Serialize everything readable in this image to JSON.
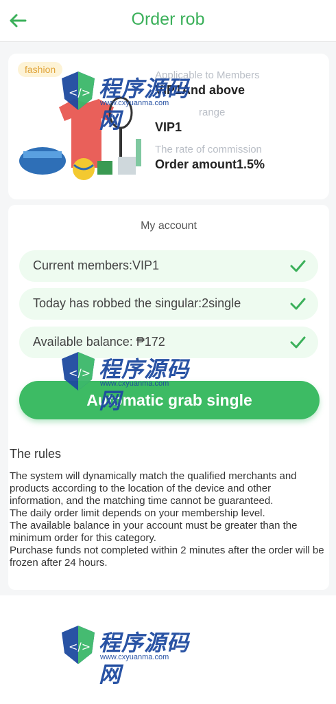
{
  "header": {
    "title": "Order rob"
  },
  "product": {
    "tag": "fashion",
    "fields": [
      {
        "label": "Applicable to Members",
        "value": "VIP1And above"
      },
      {
        "label": "range",
        "value": "VIP1"
      },
      {
        "label": "The rate of commission",
        "value": "Order amount1.5%"
      }
    ]
  },
  "account": {
    "title": "My account",
    "rows": [
      "Current members:VIP1",
      "Today has robbed the singular:2single",
      "Available balance: ₱172"
    ],
    "button": "Automatic grab single"
  },
  "rules": {
    "title": "The rules",
    "paragraphs": [
      "The system will dynamically match the qualified merchants and products according to the location of the device and other information, and the matching time cannot be guaranteed.",
      "The daily order limit depends on your membership level.",
      "The available balance in your account must be greater than the minimum order for this category.",
      "Purchase funds not completed within 2 minutes after the order will be frozen after 24 hours."
    ]
  },
  "watermark": {
    "text": "程序源码网",
    "url": "www.cxyuanma.com"
  },
  "colors": {
    "accent": "#3bb05a",
    "button": "#3dbb64",
    "row_bg": "#eefbf0"
  }
}
